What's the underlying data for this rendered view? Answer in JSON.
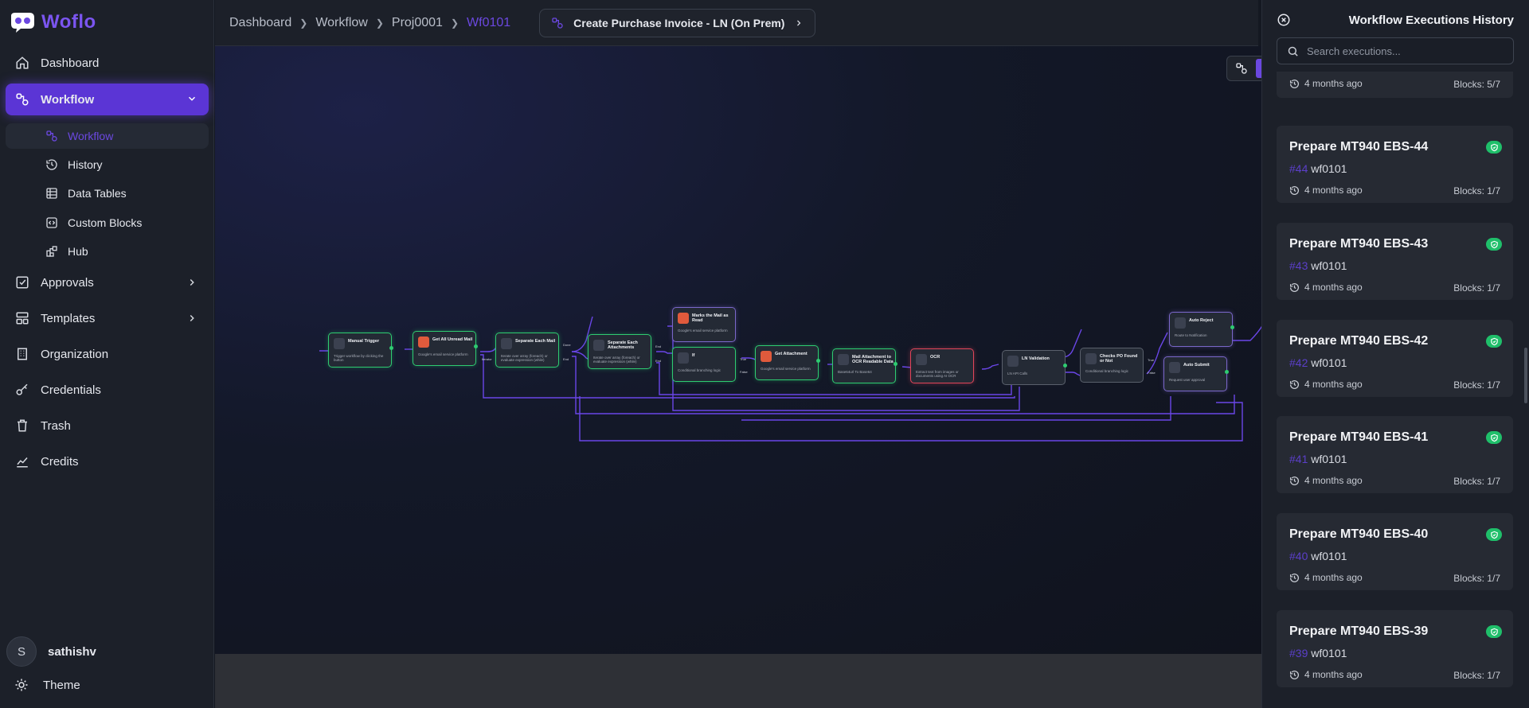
{
  "app": {
    "name": "Woflo"
  },
  "sidebar": {
    "items": [
      {
        "label": "Dashboard",
        "icon": "home-icon"
      },
      {
        "label": "Workflow",
        "icon": "workflow-icon"
      },
      {
        "label": "Approvals",
        "icon": "checkbox-icon"
      },
      {
        "label": "Templates",
        "icon": "templates-icon"
      },
      {
        "label": "Organization",
        "icon": "building-icon"
      },
      {
        "label": "Credentials",
        "icon": "key-icon"
      },
      {
        "label": "Trash",
        "icon": "trash-icon"
      },
      {
        "label": "Credits",
        "icon": "chart-icon"
      }
    ],
    "subitems": [
      {
        "label": "Workflow",
        "icon": "workflow-icon"
      },
      {
        "label": "History",
        "icon": "history-icon"
      },
      {
        "label": "Data Tables",
        "icon": "table-icon"
      },
      {
        "label": "Custom Blocks",
        "icon": "code-block-icon"
      },
      {
        "label": "Hub",
        "icon": "hub-icon"
      }
    ],
    "user": {
      "initial": "S",
      "name": "sathishv"
    },
    "theme_label": "Theme"
  },
  "breadcrumb": [
    "Dashboard",
    "Workflow",
    "Proj0001",
    "Wf0101"
  ],
  "workflow_chip": "Create Purchase Invoice - LN (On Prem)",
  "nodes": [
    {
      "title": "Manual Trigger",
      "desc": "Trigger workflow by clicking the button"
    },
    {
      "title": "Get All Unread Mail",
      "desc": "Google's email service platform"
    },
    {
      "title": "Separate Each Mail",
      "desc": "Iterate over array (foreach) or evaluate expression (while)"
    },
    {
      "title": "Separate Each Attachments",
      "desc": "Iterate over array (foreach) or evaluate expression (while)"
    },
    {
      "title": "Marks the Mail as Read",
      "desc": "Google's email service platform"
    },
    {
      "title": "If",
      "desc": "Conditional branching logic"
    },
    {
      "title": "Get Attachment",
      "desc": "Google's email service platform"
    },
    {
      "title": "Mail Attachment to OCR Readable Data",
      "desc": "Base64url To Base64"
    },
    {
      "title": "OCR",
      "desc": "Extract text from images or documents using AI OCR"
    },
    {
      "title": "LN Validation",
      "desc": "LN API Calls"
    },
    {
      "title": "Checks PO Found or Not",
      "desc": "Conditional branching logic"
    },
    {
      "title": "Auto Reject",
      "desc": "Route to Notification"
    },
    {
      "title": "Auto Submit",
      "desc": "Request user approval"
    }
  ],
  "port_labels": {
    "iterator": "Iterator",
    "end": "End",
    "done": "Done",
    "true": "True",
    "false": "False"
  },
  "panel": {
    "title": "Workflow Executions History",
    "search_placeholder": "Search executions...",
    "partial": {
      "time": "4 months ago",
      "blocks": "Blocks: 5/7"
    },
    "executions": [
      {
        "title": "Prepare MT940 EBS-44",
        "num": "#44",
        "wf": "wf0101",
        "time": "4 months ago",
        "blocks": "Blocks: 1/7"
      },
      {
        "title": "Prepare MT940 EBS-43",
        "num": "#43",
        "wf": "wf0101",
        "time": "4 months ago",
        "blocks": "Blocks: 1/7"
      },
      {
        "title": "Prepare MT940 EBS-42",
        "num": "#42",
        "wf": "wf0101",
        "time": "4 months ago",
        "blocks": "Blocks: 1/7"
      },
      {
        "title": "Prepare MT940 EBS-41",
        "num": "#41",
        "wf": "wf0101",
        "time": "4 months ago",
        "blocks": "Blocks: 1/7"
      },
      {
        "title": "Prepare MT940 EBS-40",
        "num": "#40",
        "wf": "wf0101",
        "time": "4 months ago",
        "blocks": "Blocks: 1/7"
      },
      {
        "title": "Prepare MT940 EBS-39",
        "num": "#39",
        "wf": "wf0101",
        "time": "4 months ago",
        "blocks": "Blocks: 1/7"
      }
    ]
  },
  "colors": {
    "accent": "#6b48e0",
    "success": "#2ecc71",
    "error": "#e0455a",
    "edge": "#6a46e8"
  }
}
